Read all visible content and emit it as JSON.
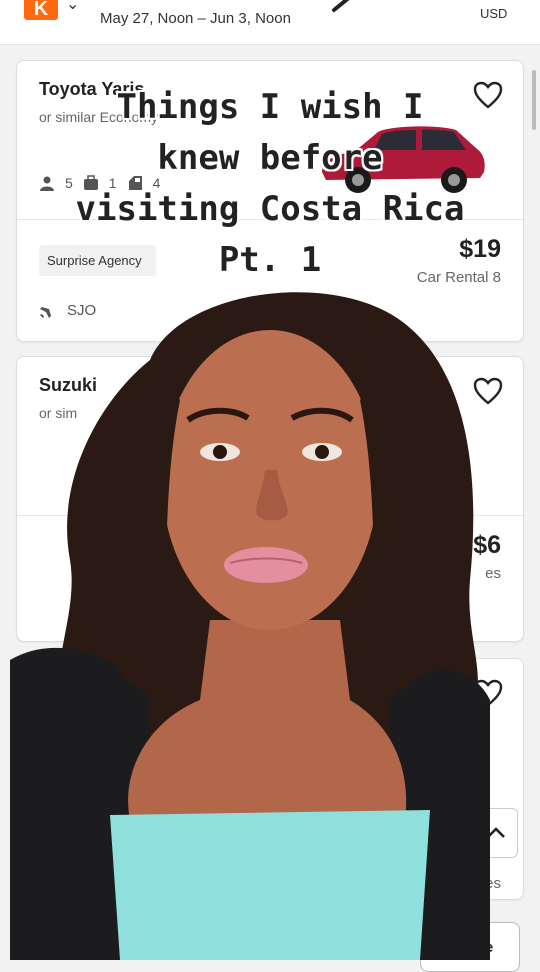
{
  "header": {
    "logo_letter": "K",
    "dates": "May 27, Noon – Jun 3, Noon",
    "currency": "USD"
  },
  "cards": [
    {
      "title": "Toyota Yaris",
      "subtitle": "or similar Economy",
      "passengers": "5",
      "bags": "1",
      "doors": "4",
      "agency": "Surprise Agency",
      "price": "$19",
      "price_sub": "Car Rental 8",
      "airport": "SJO"
    },
    {
      "title": "Suzuki",
      "subtitle": "or sim",
      "price": "$6",
      "price_sub": "es"
    },
    {
      "price_sub": "es"
    }
  ],
  "bottom_button": "re",
  "caption": {
    "lines": [
      "Things I wish I",
      "knew before",
      "visiting Costa Rica",
      "Pt. 1"
    ]
  },
  "colors": {
    "brand": "#ff690f",
    "car": "#b01a3a",
    "top": "#8fe0dc"
  }
}
